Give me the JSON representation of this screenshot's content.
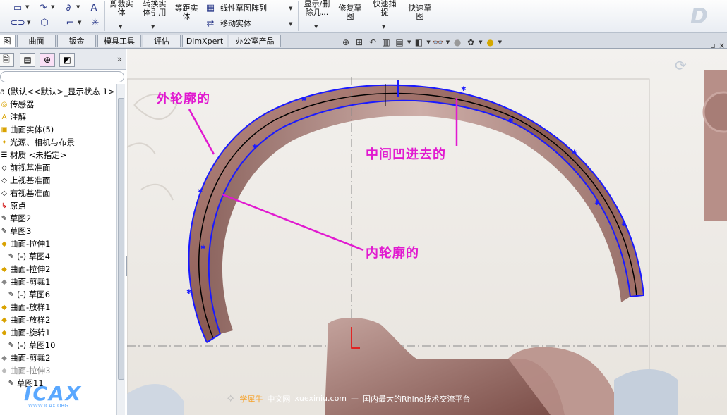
{
  "ribbon": {
    "trim_surface": [
      "剪裁实",
      "体"
    ],
    "convert_entities": [
      "转换实",
      "体引用"
    ],
    "offset_entities": [
      "等距实",
      "体"
    ],
    "linear_pattern": "线性草图阵列",
    "move_entities": "移动实体",
    "show_hide": [
      "显示/删",
      "除几..."
    ],
    "repair_sketch": [
      "修复草",
      "图"
    ],
    "quick_snap": [
      "快速捕",
      "捉"
    ],
    "rapid_sketch": [
      "快速草",
      "图"
    ]
  },
  "tabs": [
    {
      "label": "图"
    },
    {
      "label": "曲面"
    },
    {
      "label": "钣金"
    },
    {
      "label": "模具工具"
    },
    {
      "label": "评估"
    },
    {
      "label": "DimXpert"
    },
    {
      "label": "办公室产品"
    }
  ],
  "tree": {
    "root": "a (默认<<默认>_显示状态 1>",
    "items": [
      {
        "label": "传感器",
        "icon": "sensor-icon"
      },
      {
        "label": "注解",
        "icon": "annotation-icon"
      },
      {
        "label": "曲面实体(5)",
        "icon": "surface-bodies-icon"
      },
      {
        "label": "光源、相机与布景",
        "icon": "lights-icon"
      },
      {
        "label": "材质 <未指定>",
        "icon": "material-icon"
      },
      {
        "label": "前视基准面",
        "icon": "plane-icon"
      },
      {
        "label": "上视基准面",
        "icon": "plane-icon"
      },
      {
        "label": "右视基准面",
        "icon": "plane-icon"
      },
      {
        "label": "原点",
        "icon": "origin-icon"
      },
      {
        "label": "草图2",
        "icon": "sketch-icon"
      },
      {
        "label": "草图3",
        "icon": "sketch-icon"
      },
      {
        "label": "曲面-拉伸1",
        "icon": "surface-extrude-icon"
      },
      {
        "label": "(-) 草图4",
        "icon": "sketch-icon"
      },
      {
        "label": "曲面-拉伸2",
        "icon": "surface-extrude-icon"
      },
      {
        "label": "曲面-剪裁1",
        "icon": "surface-trim-icon"
      },
      {
        "label": "(-) 草图6",
        "icon": "sketch-icon"
      },
      {
        "label": "曲面-放样1",
        "icon": "surface-loft-icon"
      },
      {
        "label": "曲面-放样2",
        "icon": "surface-loft-icon"
      },
      {
        "label": "曲面-旋转1",
        "icon": "surface-revolve-icon"
      },
      {
        "label": "(-) 草图10",
        "icon": "sketch-icon"
      },
      {
        "label": "曲面-剪裁2",
        "icon": "surface-trim-icon"
      },
      {
        "label": "曲面-拉伸3",
        "icon": "surface-extrude-icon"
      },
      {
        "label": "草图11",
        "icon": "sketch-icon"
      }
    ]
  },
  "annotations": {
    "outer_profile": "外轮廓的",
    "middle_recess": "中间凹进去的",
    "inner_profile": "内轮廓的"
  },
  "watermark": {
    "site_name": "学犀牛",
    "site_cn": "中文网",
    "url": "xuexiniu.com",
    "dash": "—",
    "slogan": "国内最大的Rhino技术交流平台",
    "logo_text": "ICAX",
    "logo_url": "WWW.ICAX.ORG"
  },
  "colors": {
    "annotation": "#e11ad0",
    "sketch_blue": "#1a1aff",
    "model_brown": "#8a5a52"
  }
}
